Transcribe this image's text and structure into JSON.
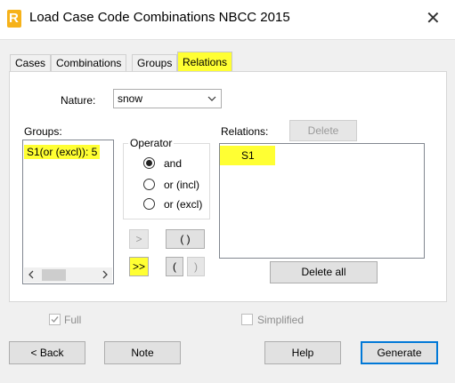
{
  "window": {
    "title": "Load Case Code Combinations NBCC 2015",
    "app_icon_letter": "R",
    "close_glyph": "✕"
  },
  "tabs": [
    {
      "label": "Cases",
      "active": false
    },
    {
      "label": "Combinations",
      "active": false
    },
    {
      "label": "Groups",
      "active": false
    },
    {
      "label": "Relations",
      "active": true
    }
  ],
  "nature": {
    "label": "Nature:",
    "value": "snow"
  },
  "groups": {
    "label": "Groups:",
    "items": [
      "S1(or (excl)): 5"
    ]
  },
  "operator": {
    "label": "Operator",
    "options": [
      {
        "label": "and",
        "checked": true
      },
      {
        "label": "or (incl)",
        "checked": false
      },
      {
        "label": "or (excl)",
        "checked": false
      }
    ]
  },
  "operator_buttons": {
    "add": ">",
    "add_all": ">>",
    "parens": "( )",
    "open_paren": "(",
    "close_paren": ")"
  },
  "relations": {
    "label": "Relations:",
    "delete_label": "Delete",
    "items": [
      "S1"
    ],
    "delete_all_label": "Delete all"
  },
  "options": {
    "full_label": "Full",
    "full_checked": true,
    "simplified_label": "Simplified",
    "simplified_checked": false
  },
  "footer": {
    "back_label": "< Back",
    "note_label": "Note",
    "help_label": "Help",
    "generate_label": "Generate"
  },
  "colors": {
    "highlight": "#ffff33",
    "accent": "#0078d7"
  },
  "icons": {
    "dropdown": "chevron-down-icon",
    "scroll_left": "arrow-left-icon",
    "scroll_right": "arrow-right-icon",
    "check": "checkmark-icon"
  }
}
